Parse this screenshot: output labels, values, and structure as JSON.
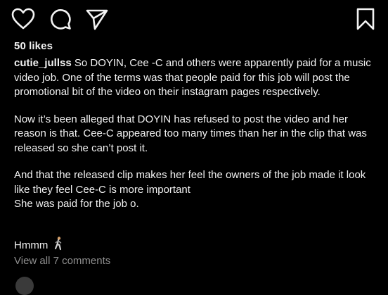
{
  "post": {
    "likes": "50 likes",
    "username": "cutie_jullss",
    "caption_p1": " So DOYIN, Cee -C and others were apparently paid for a music video job. One of the terms was that people paid for this job will post the promotional bit of the video on their instagram pages respectively.",
    "caption_p2": "Now it’s been alleged that DOYIN has refused to post the video and her reason is that. Cee-C appeared too many times than her in the clip that was released so she can’t post it.",
    "caption_p3_line1": "And that the released clip makes her feel the owners of the job made it look like they feel Cee-C is more important",
    "caption_p3_line2": "She was paid for the job o.",
    "reaction_text": "Hmmm",
    "reaction_emoji": "person-walking-emoji",
    "view_comments": "View all 7 comments"
  },
  "icons": {
    "like": "heart-icon",
    "comment": "comment-icon",
    "share": "paper-plane-icon",
    "save": "bookmark-icon"
  },
  "colors": {
    "background": "#000000",
    "text": "#f2f2f2",
    "muted": "#8e8e8e"
  }
}
